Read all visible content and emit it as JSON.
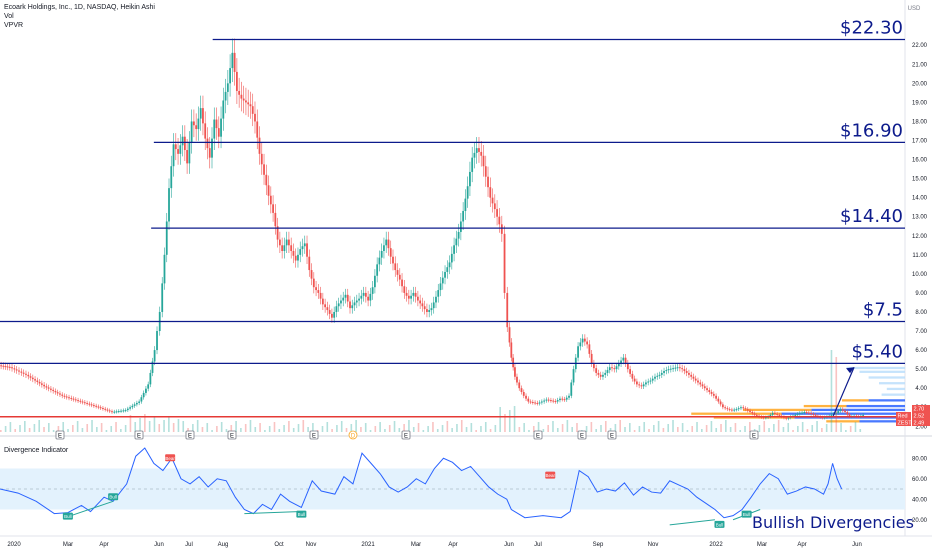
{
  "legend": {
    "symbol_line": "Ecoark Holdings, Inc., 1D, NASDAQ, Heikin Ashi",
    "volume": "Vol",
    "vpvr": "VPVR"
  },
  "indicator": {
    "title": "Divergence Indicator"
  },
  "colors": {
    "up": "#26a69a",
    "down": "#ef5350",
    "level_line": "#0d1b8c",
    "support_line": "#e53935",
    "indicator_line": "#2962ff",
    "indicator_band": "#e3f2fd",
    "vpvr_blue": "#2962ff",
    "vpvr_orange": "#ff9800"
  },
  "chart_data": [
    {
      "type": "candlestick",
      "title": "",
      "y_axis": {
        "unit": "USD",
        "ticks": [
          "22.00",
          "21.00",
          "20.00",
          "19.00",
          "18.00",
          "17.00",
          "16.00",
          "15.00",
          "14.00",
          "13.00",
          "12.00",
          "11.00",
          "10.00",
          "9.00",
          "8.00",
          "7.00",
          "6.00",
          "5.00",
          "4.00",
          "3.00",
          "2.00"
        ],
        "price_tags": [
          {
            "label": "2.70",
            "value": 2.7,
            "color": "#ef5350"
          },
          {
            "label": "Red",
            "value": 2.52,
            "color": "#ef5350"
          },
          {
            "label": "2.52",
            "value": 2.52,
            "color": "#ef5350"
          },
          {
            "label": "ZEST",
            "value": 2.49,
            "color": "#ef5350"
          },
          {
            "label": "2.49",
            "value": 2.49,
            "color": "#ef5350"
          }
        ]
      },
      "x_axis": {
        "ticks": [
          "2020",
          "Mar",
          "Apr",
          "Jun",
          "Jul",
          "Aug",
          "Oct",
          "Nov",
          "2021",
          "Mar",
          "Apr",
          "Jun",
          "Jul",
          "Sep",
          "Nov",
          "2022",
          "Mar",
          "Apr",
          "Jun"
        ]
      },
      "levels": [
        {
          "label": "$22.30",
          "value": 22.3
        },
        {
          "label": "$16.90",
          "value": 16.9
        },
        {
          "label": "$14.40",
          "value": 12.4
        },
        {
          "label": "$7.5",
          "value": 7.5
        },
        {
          "label": "$5.40",
          "value": 5.3
        }
      ],
      "support_level": 2.5,
      "event_markers": [
        "E",
        "E",
        "E",
        "E",
        "E",
        "D",
        "E",
        "E",
        "E",
        "E",
        "E"
      ],
      "trend_arrow": {
        "from": [
          0.965,
          2.55
        ],
        "to": [
          0.999,
          5.1
        ]
      },
      "price_path": [
        [
          0.0,
          5.2
        ],
        [
          0.012,
          5.1
        ],
        [
          0.03,
          4.7
        ],
        [
          0.05,
          4.1
        ],
        [
          0.07,
          3.6
        ],
        [
          0.09,
          3.3
        ],
        [
          0.11,
          3.0
        ],
        [
          0.125,
          2.75
        ],
        [
          0.14,
          2.85
        ],
        [
          0.155,
          3.3
        ],
        [
          0.165,
          4.2
        ],
        [
          0.172,
          6.0
        ],
        [
          0.178,
          8.0
        ],
        [
          0.183,
          11.0
        ],
        [
          0.188,
          14.5
        ],
        [
          0.193,
          16.8
        ],
        [
          0.198,
          16.3
        ],
        [
          0.203,
          17.2
        ],
        [
          0.208,
          15.8
        ],
        [
          0.213,
          18.0
        ],
        [
          0.218,
          17.6
        ],
        [
          0.223,
          18.7
        ],
        [
          0.228,
          17.1
        ],
        [
          0.233,
          16.1
        ],
        [
          0.238,
          18.1
        ],
        [
          0.243,
          17.2
        ],
        [
          0.248,
          19.1
        ],
        [
          0.253,
          20.0
        ],
        [
          0.258,
          21.6
        ],
        [
          0.263,
          19.6
        ],
        [
          0.268,
          19.2
        ],
        [
          0.273,
          19.0
        ],
        [
          0.278,
          18.8
        ],
        [
          0.283,
          18.0
        ],
        [
          0.288,
          16.3
        ],
        [
          0.293,
          15.2
        ],
        [
          0.298,
          14.1
        ],
        [
          0.303,
          13.2
        ],
        [
          0.308,
          11.8
        ],
        [
          0.313,
          11.2
        ],
        [
          0.318,
          11.8
        ],
        [
          0.323,
          11.2
        ],
        [
          0.328,
          10.7
        ],
        [
          0.333,
          11.3
        ],
        [
          0.338,
          11.6
        ],
        [
          0.343,
          10.2
        ],
        [
          0.348,
          9.3
        ],
        [
          0.353,
          9.0
        ],
        [
          0.358,
          8.4
        ],
        [
          0.363,
          8.1
        ],
        [
          0.368,
          7.7
        ],
        [
          0.373,
          8.3
        ],
        [
          0.378,
          8.6
        ],
        [
          0.383,
          8.9
        ],
        [
          0.388,
          8.2
        ],
        [
          0.393,
          8.5
        ],
        [
          0.398,
          8.7
        ],
        [
          0.403,
          9.0
        ],
        [
          0.408,
          8.6
        ],
        [
          0.413,
          9.3
        ],
        [
          0.418,
          10.5
        ],
        [
          0.423,
          11.2
        ],
        [
          0.428,
          11.8
        ],
        [
          0.433,
          10.9
        ],
        [
          0.438,
          10.2
        ],
        [
          0.443,
          9.7
        ],
        [
          0.448,
          9.0
        ],
        [
          0.453,
          8.7
        ],
        [
          0.458,
          9.0
        ],
        [
          0.463,
          8.6
        ],
        [
          0.468,
          8.3
        ],
        [
          0.473,
          8.0
        ],
        [
          0.478,
          8.2
        ],
        [
          0.483,
          8.8
        ],
        [
          0.488,
          9.5
        ],
        [
          0.493,
          10.1
        ],
        [
          0.498,
          10.6
        ],
        [
          0.503,
          11.5
        ],
        [
          0.508,
          12.2
        ],
        [
          0.513,
          13.3
        ],
        [
          0.518,
          14.6
        ],
        [
          0.523,
          16.1
        ],
        [
          0.528,
          16.6
        ],
        [
          0.533,
          16.2
        ],
        [
          0.538,
          15.1
        ],
        [
          0.543,
          14.0
        ],
        [
          0.548,
          13.4
        ],
        [
          0.553,
          12.6
        ],
        [
          0.556,
          12.1
        ],
        [
          0.559,
          9.0
        ],
        [
          0.562,
          7.2
        ],
        [
          0.566,
          5.6
        ],
        [
          0.57,
          4.6
        ],
        [
          0.575,
          4.0
        ],
        [
          0.58,
          3.6
        ],
        [
          0.585,
          3.3
        ],
        [
          0.59,
          3.25
        ],
        [
          0.595,
          3.2
        ],
        [
          0.6,
          3.3
        ],
        [
          0.605,
          3.4
        ],
        [
          0.61,
          3.35
        ],
        [
          0.615,
          3.3
        ],
        [
          0.62,
          3.45
        ],
        [
          0.625,
          3.4
        ],
        [
          0.63,
          3.6
        ],
        [
          0.635,
          5.0
        ],
        [
          0.64,
          6.2
        ],
        [
          0.645,
          6.6
        ],
        [
          0.65,
          6.3
        ],
        [
          0.655,
          5.3
        ],
        [
          0.66,
          4.8
        ],
        [
          0.665,
          4.6
        ],
        [
          0.67,
          4.8
        ],
        [
          0.675,
          5.1
        ],
        [
          0.68,
          5.0
        ],
        [
          0.685,
          5.3
        ],
        [
          0.69,
          5.6
        ],
        [
          0.695,
          5.0
        ],
        [
          0.7,
          4.5
        ],
        [
          0.705,
          4.2
        ],
        [
          0.71,
          4.1
        ],
        [
          0.715,
          4.3
        ],
        [
          0.72,
          4.4
        ],
        [
          0.725,
          4.6
        ],
        [
          0.73,
          4.7
        ],
        [
          0.735,
          4.9
        ],
        [
          0.74,
          5.0
        ],
        [
          0.745,
          5.05
        ],
        [
          0.75,
          5.1
        ],
        [
          0.755,
          5.0
        ],
        [
          0.76,
          4.8
        ],
        [
          0.765,
          4.6
        ],
        [
          0.77,
          4.4
        ],
        [
          0.775,
          4.2
        ],
        [
          0.78,
          4.0
        ],
        [
          0.785,
          3.8
        ],
        [
          0.79,
          3.6
        ],
        [
          0.795,
          3.3
        ],
        [
          0.8,
          3.0
        ],
        [
          0.805,
          2.9
        ],
        [
          0.81,
          2.85
        ],
        [
          0.815,
          2.9
        ],
        [
          0.82,
          3.0
        ],
        [
          0.825,
          2.9
        ],
        [
          0.83,
          2.75
        ],
        [
          0.835,
          2.6
        ],
        [
          0.84,
          2.5
        ],
        [
          0.845,
          2.45
        ],
        [
          0.85,
          2.5
        ],
        [
          0.855,
          2.7
        ],
        [
          0.86,
          2.6
        ],
        [
          0.865,
          2.5
        ],
        [
          0.87,
          2.4
        ],
        [
          0.875,
          2.5
        ],
        [
          0.88,
          2.6
        ],
        [
          0.885,
          2.7
        ],
        [
          0.89,
          2.75
        ],
        [
          0.895,
          2.7
        ],
        [
          0.9,
          2.6
        ],
        [
          0.905,
          2.5
        ],
        [
          0.91,
          2.45
        ],
        [
          0.915,
          2.5
        ],
        [
          0.92,
          2.6
        ],
        [
          0.925,
          2.7
        ],
        [
          0.93,
          2.9
        ],
        [
          0.935,
          2.75
        ],
        [
          0.94,
          2.5
        ],
        [
          0.945,
          2.55
        ],
        [
          0.95,
          2.5
        ],
        [
          0.955,
          2.6
        ]
      ]
    },
    {
      "type": "line",
      "title": "Divergence Indicator",
      "y_axis": {
        "ticks": [
          "80.00",
          "60.00",
          "40.00",
          "20.00"
        ],
        "range": [
          10,
          90
        ],
        "band": [
          30,
          70
        ]
      },
      "signals": [
        {
          "label": "Bear",
          "at": 0.188,
          "value": 80
        },
        {
          "label": "Bull",
          "at": 0.125,
          "value": 42
        },
        {
          "label": "Bull",
          "at": 0.075,
          "value": 23
        },
        {
          "label": "Bull",
          "at": 0.333,
          "value": 25
        },
        {
          "label": "Bear",
          "at": 0.608,
          "value": 63
        },
        {
          "label": "Bull",
          "at": 0.795,
          "value": 15
        },
        {
          "label": "Bull",
          "at": 0.825,
          "value": 25
        }
      ],
      "annotation": "Bullish Divergencies",
      "series": [
        {
          "values": [
            [
              0.0,
              50
            ],
            [
              0.02,
              46
            ],
            [
              0.04,
              38
            ],
            [
              0.06,
              26
            ],
            [
              0.075,
              27
            ],
            [
              0.09,
              34
            ],
            [
              0.1,
              28
            ],
            [
              0.115,
              42
            ],
            [
              0.125,
              38
            ],
            [
              0.14,
              55
            ],
            [
              0.15,
              82
            ],
            [
              0.16,
              90
            ],
            [
              0.17,
              75
            ],
            [
              0.18,
              68
            ],
            [
              0.19,
              80
            ],
            [
              0.2,
              60
            ],
            [
              0.21,
              55
            ],
            [
              0.22,
              62
            ],
            [
              0.23,
              52
            ],
            [
              0.24,
              60
            ],
            [
              0.25,
              58
            ],
            [
              0.26,
              42
            ],
            [
              0.27,
              30
            ],
            [
              0.28,
              26
            ],
            [
              0.29,
              35
            ],
            [
              0.3,
              30
            ],
            [
              0.31,
              45
            ],
            [
              0.32,
              38
            ],
            [
              0.333,
              32
            ],
            [
              0.345,
              58
            ],
            [
              0.355,
              48
            ],
            [
              0.37,
              45
            ],
            [
              0.38,
              62
            ],
            [
              0.39,
              55
            ],
            [
              0.4,
              85
            ],
            [
              0.41,
              75
            ],
            [
              0.42,
              65
            ],
            [
              0.43,
              52
            ],
            [
              0.44,
              47
            ],
            [
              0.45,
              52
            ],
            [
              0.46,
              60
            ],
            [
              0.47,
              55
            ],
            [
              0.48,
              70
            ],
            [
              0.49,
              80
            ],
            [
              0.5,
              76
            ],
            [
              0.51,
              68
            ],
            [
              0.52,
              72
            ],
            [
              0.53,
              62
            ],
            [
              0.54,
              52
            ],
            [
              0.55,
              45
            ],
            [
              0.56,
              40
            ],
            [
              0.565,
              30
            ],
            [
              0.58,
              22
            ],
            [
              0.6,
              24
            ],
            [
              0.62,
              22
            ],
            [
              0.63,
              28
            ],
            [
              0.64,
              68
            ],
            [
              0.65,
              62
            ],
            [
              0.66,
              47
            ],
            [
              0.67,
              50
            ],
            [
              0.68,
              48
            ],
            [
              0.69,
              56
            ],
            [
              0.7,
              44
            ],
            [
              0.71,
              52
            ],
            [
              0.72,
              47
            ],
            [
              0.73,
              46
            ],
            [
              0.74,
              58
            ],
            [
              0.75,
              54
            ],
            [
              0.76,
              50
            ],
            [
              0.77,
              42
            ],
            [
              0.78,
              36
            ],
            [
              0.79,
              30
            ],
            [
              0.8,
              22
            ],
            [
              0.81,
              24
            ],
            [
              0.82,
              30
            ],
            [
              0.83,
              42
            ],
            [
              0.84,
              55
            ],
            [
              0.85,
              65
            ],
            [
              0.86,
              60
            ],
            [
              0.87,
              45
            ],
            [
              0.88,
              48
            ],
            [
              0.89,
              52
            ],
            [
              0.9,
              50
            ],
            [
              0.91,
              45
            ],
            [
              0.915,
              55
            ],
            [
              0.92,
              75
            ],
            [
              0.925,
              60
            ],
            [
              0.93,
              50
            ]
          ]
        }
      ]
    }
  ]
}
